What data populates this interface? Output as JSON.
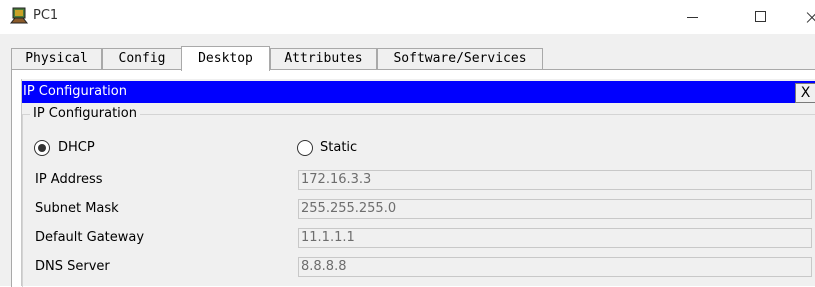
{
  "window": {
    "title": "PC1",
    "icon": "pc-icon"
  },
  "tabs": [
    {
      "label": "Physical"
    },
    {
      "label": "Config"
    },
    {
      "label": "Desktop"
    },
    {
      "label": "Attributes"
    },
    {
      "label": "Software/Services"
    }
  ],
  "active_tab": "Desktop",
  "ip_config": {
    "title": "IP Configuration",
    "close_label": "X",
    "group_label": "IP Configuration",
    "dhcp_label": "DHCP",
    "static_label": "Static",
    "selected_mode": "DHCP",
    "ip_address_label": "IP Address",
    "ip_address": "172.16.3.3",
    "subnet_mask_label": "Subnet Mask",
    "subnet_mask": "255.255.255.0",
    "gateway_label": "Default Gateway",
    "gateway": "11.1.1.1",
    "dns_label": "DNS Server",
    "dns": "8.8.8.8"
  },
  "colors": {
    "title_bar": "#0000ff",
    "panel_bg": "#f0f0f0"
  }
}
